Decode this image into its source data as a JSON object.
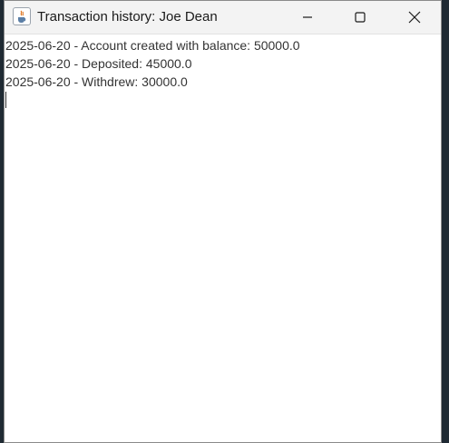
{
  "window": {
    "title": "Transaction history: Joe Dean",
    "app_icon": "java-cup-icon",
    "controls": {
      "minimize_icon": "minimize-icon",
      "maximize_icon": "maximize-icon",
      "close_icon": "close-icon"
    }
  },
  "history": {
    "lines": [
      "2025-06-20 - Account created with balance: 50000.0",
      "2025-06-20 - Deposited: 45000.0",
      "2025-06-20 - Withdrew: 30000.0"
    ]
  },
  "colors": {
    "titlebar": "#f3f3f3",
    "content_bg": "#ffffff",
    "text": "#333333",
    "desktop": "#1f2a33"
  }
}
